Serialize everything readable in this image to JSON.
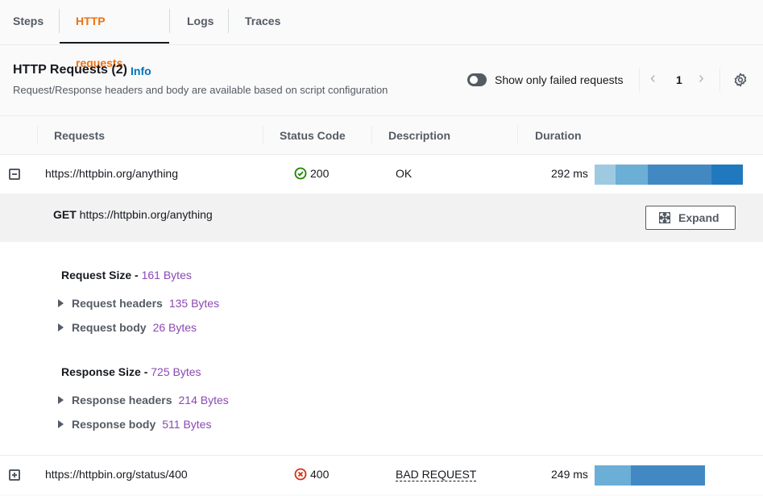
{
  "tabs": [
    {
      "label": "Steps",
      "active": false
    },
    {
      "label": "HTTP requests",
      "active": true
    },
    {
      "label": "Logs",
      "active": false
    },
    {
      "label": "Traces",
      "active": false
    }
  ],
  "header": {
    "title": "HTTP Requests (2)",
    "info_label": "Info",
    "description": "Request/Response headers and body are available based on script configuration",
    "toggle_label": "Show only failed requests",
    "toggle_on": false,
    "page_number": "1",
    "icons": {
      "prev": "chevron-left-icon",
      "next": "chevron-right-icon",
      "settings": "gear-icon"
    }
  },
  "columns": [
    "Requests",
    "Status Code",
    "Description",
    "Duration"
  ],
  "colors": {
    "accent": "#ec7211",
    "link": "#0073bb",
    "success": "#1d8102",
    "error": "#d13212",
    "bytes": "#8b48b3"
  },
  "rows": [
    {
      "url": "https://httpbin.org/anything",
      "status": "200",
      "status_type": "success",
      "description": "OK",
      "duration": "292 ms",
      "expanded": true,
      "timing_segments": [
        {
          "fraction": 0.14,
          "color": "#9ecae1"
        },
        {
          "fraction": 0.22,
          "color": "#6baed6"
        },
        {
          "fraction": 0.43,
          "color": "#4289c3"
        },
        {
          "fraction": 0.21,
          "color": "#2079be"
        }
      ]
    },
    {
      "url": "https://httpbin.org/status/400",
      "status": "400",
      "status_type": "error",
      "description": "BAD REQUEST",
      "duration": "249 ms",
      "expanded": false,
      "timing_segments": [
        {
          "fraction": 0.33,
          "color": "#6baed6"
        },
        {
          "fraction": 0.67,
          "color": "#4289c3"
        }
      ]
    }
  ],
  "detail": {
    "method": "GET",
    "url": "https://httpbin.org/anything",
    "expand_label": "Expand",
    "request_size_label": "Request Size -",
    "request_size": "161 Bytes",
    "request_headers_label": "Request headers",
    "request_headers_size": "135 Bytes",
    "request_body_label": "Request body",
    "request_body_size": "26 Bytes",
    "response_size_label": "Response Size -",
    "response_size": "725 Bytes",
    "response_headers_label": "Response headers",
    "response_headers_size": "214 Bytes",
    "response_body_label": "Response body",
    "response_body_size": "511 Bytes"
  }
}
